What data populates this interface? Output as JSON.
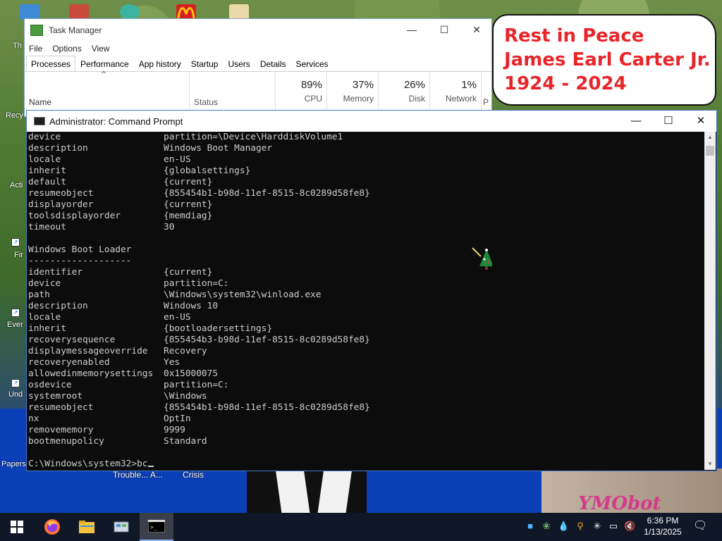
{
  "desktop": {
    "labels": [
      "Th",
      "Recy",
      "Acti",
      "Fir",
      "Ever",
      "Und",
      "Papers"
    ],
    "captions": [
      "Trouble... A...",
      "Crisis"
    ],
    "watermark": "YMObot"
  },
  "note": {
    "lines": [
      "Rest in Peace",
      "James Earl Carter Jr.",
      "1924 - 2024"
    ]
  },
  "task_manager": {
    "title": "Task Manager",
    "menu": [
      "File",
      "Options",
      "View"
    ],
    "tabs": [
      "Processes",
      "Performance",
      "App history",
      "Startup",
      "Users",
      "Details",
      "Services"
    ],
    "active_tab": "Processes",
    "columns": {
      "name": "Name",
      "status": "Status",
      "cpu": {
        "pct": "89%",
        "label": "CPU"
      },
      "memory": {
        "pct": "37%",
        "label": "Memory"
      },
      "disk": {
        "pct": "26%",
        "label": "Disk"
      },
      "network": {
        "pct": "1%",
        "label": "Network"
      },
      "power_partial": "P"
    }
  },
  "cmd": {
    "title": "Administrator: Command Prompt",
    "lines": [
      [
        "device",
        "partition=\\Device\\HarddiskVolume1"
      ],
      [
        "description",
        "Windows Boot Manager"
      ],
      [
        "locale",
        "en-US"
      ],
      [
        "inherit",
        "{globalsettings}"
      ],
      [
        "default",
        "{current}"
      ],
      [
        "resumeobject",
        "{855454b1-b98d-11ef-8515-8c0289d58fe8}"
      ],
      [
        "displayorder",
        "{current}"
      ],
      [
        "toolsdisplayorder",
        "{memdiag}"
      ],
      [
        "timeout",
        "30"
      ],
      [
        "",
        ""
      ],
      [
        "Windows Boot Loader",
        ""
      ],
      [
        "-------------------",
        ""
      ],
      [
        "identifier",
        "{current}"
      ],
      [
        "device",
        "partition=C:"
      ],
      [
        "path",
        "\\Windows\\system32\\winload.exe"
      ],
      [
        "description",
        "Windows 10"
      ],
      [
        "locale",
        "en-US"
      ],
      [
        "inherit",
        "{bootloadersettings}"
      ],
      [
        "recoverysequence",
        "{855454b3-b98d-11ef-8515-8c0289d58fe8}"
      ],
      [
        "displaymessageoverride",
        "Recovery"
      ],
      [
        "recoveryenabled",
        "Yes"
      ],
      [
        "allowedinmemorysettings",
        "0x15000075"
      ],
      [
        "osdevice",
        "partition=C:"
      ],
      [
        "systemroot",
        "\\Windows"
      ],
      [
        "resumeobject",
        "{855454b1-b98d-11ef-8515-8c0289d58fe8}"
      ],
      [
        "nx",
        "OptIn"
      ],
      [
        "removememory",
        "9999"
      ],
      [
        "bootmenupolicy",
        "Standard"
      ],
      [
        "",
        ""
      ]
    ],
    "prompt": "C:\\Windows\\system32>bc"
  },
  "taskbar": {
    "time": "6:36 PM",
    "date": "1/13/2025",
    "pinned": [
      "windows-start-icon",
      "firefox-icon",
      "file-explorer-icon",
      "control-panel-icon",
      "command-prompt-icon"
    ],
    "tray": [
      "notes-icon",
      "tray-app-icon",
      "water-drop-icon",
      "search-magnifier-icon",
      "network-star-icon",
      "network-icon",
      "volume-muted-icon",
      "notifications-icon"
    ]
  }
}
